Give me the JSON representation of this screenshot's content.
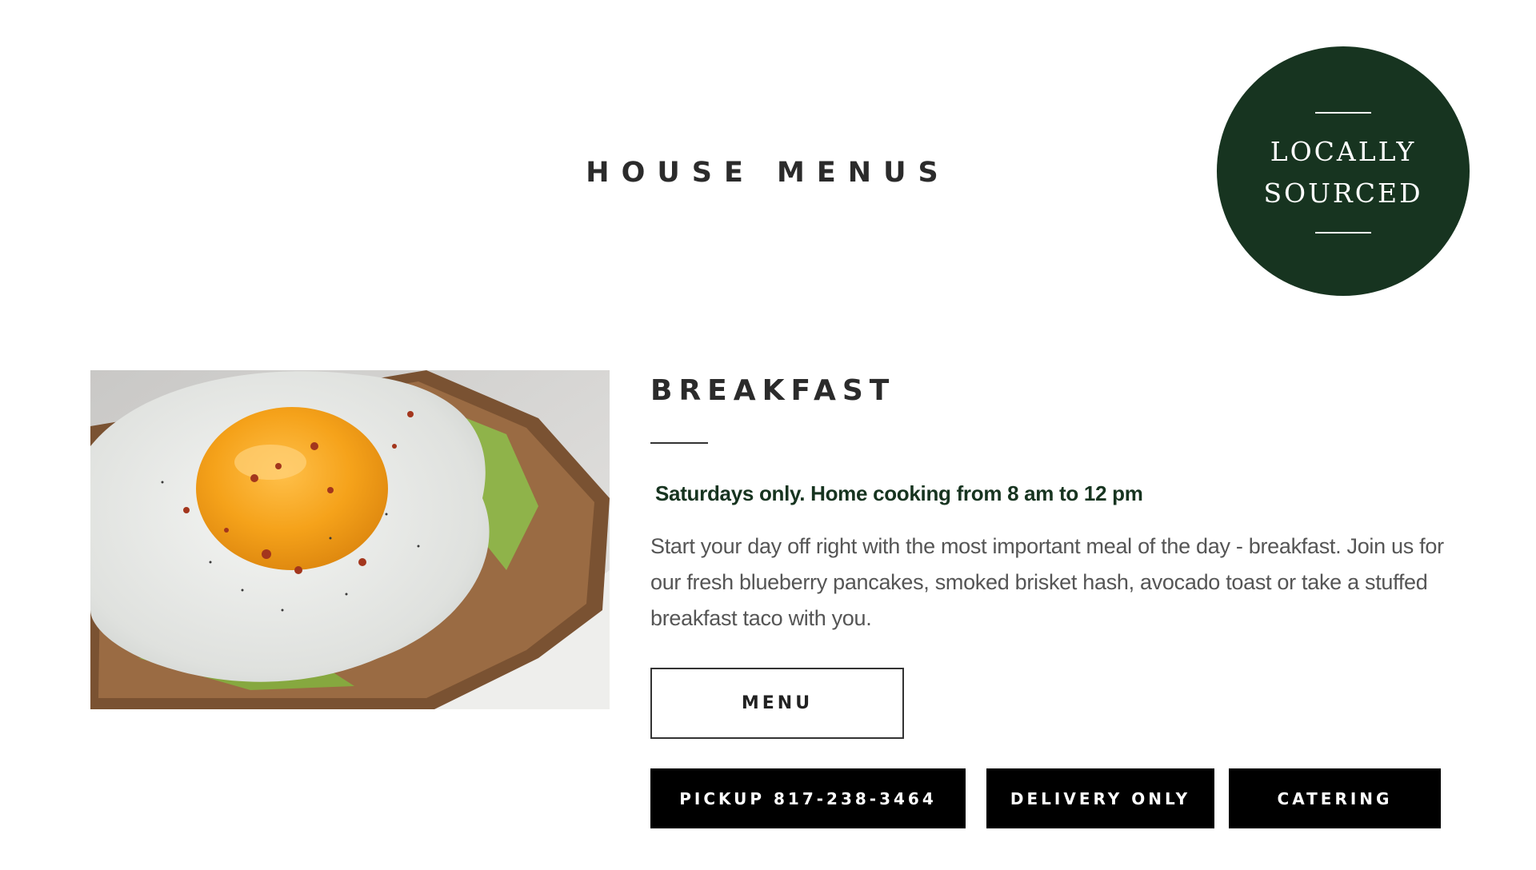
{
  "page": {
    "title": "HOUSE MENUS"
  },
  "badge": {
    "line1": "LOCALLY",
    "line2": "SOURCED",
    "color": "#173420"
  },
  "photo": {
    "subject": "fried egg on avocado toast"
  },
  "section": {
    "title": "BREAKFAST",
    "subtitle": "Saturdays only. Home cooking from 8 am to 12 pm",
    "description": "Start your day off right with the most important meal of the day - breakfast. Join us for our fresh blueberry pancakes, smoked brisket hash, avocado toast or take a stuffed breakfast taco with you.",
    "menu_button": "MENU"
  },
  "actions": {
    "pickup": "PICKUP 817-238-3464",
    "delivery": "DELIVERY ONLY",
    "catering": "CATERING"
  },
  "colors": {
    "accent_green": "#173420",
    "button_black": "#000000",
    "text_dark": "#2b2b2b"
  }
}
